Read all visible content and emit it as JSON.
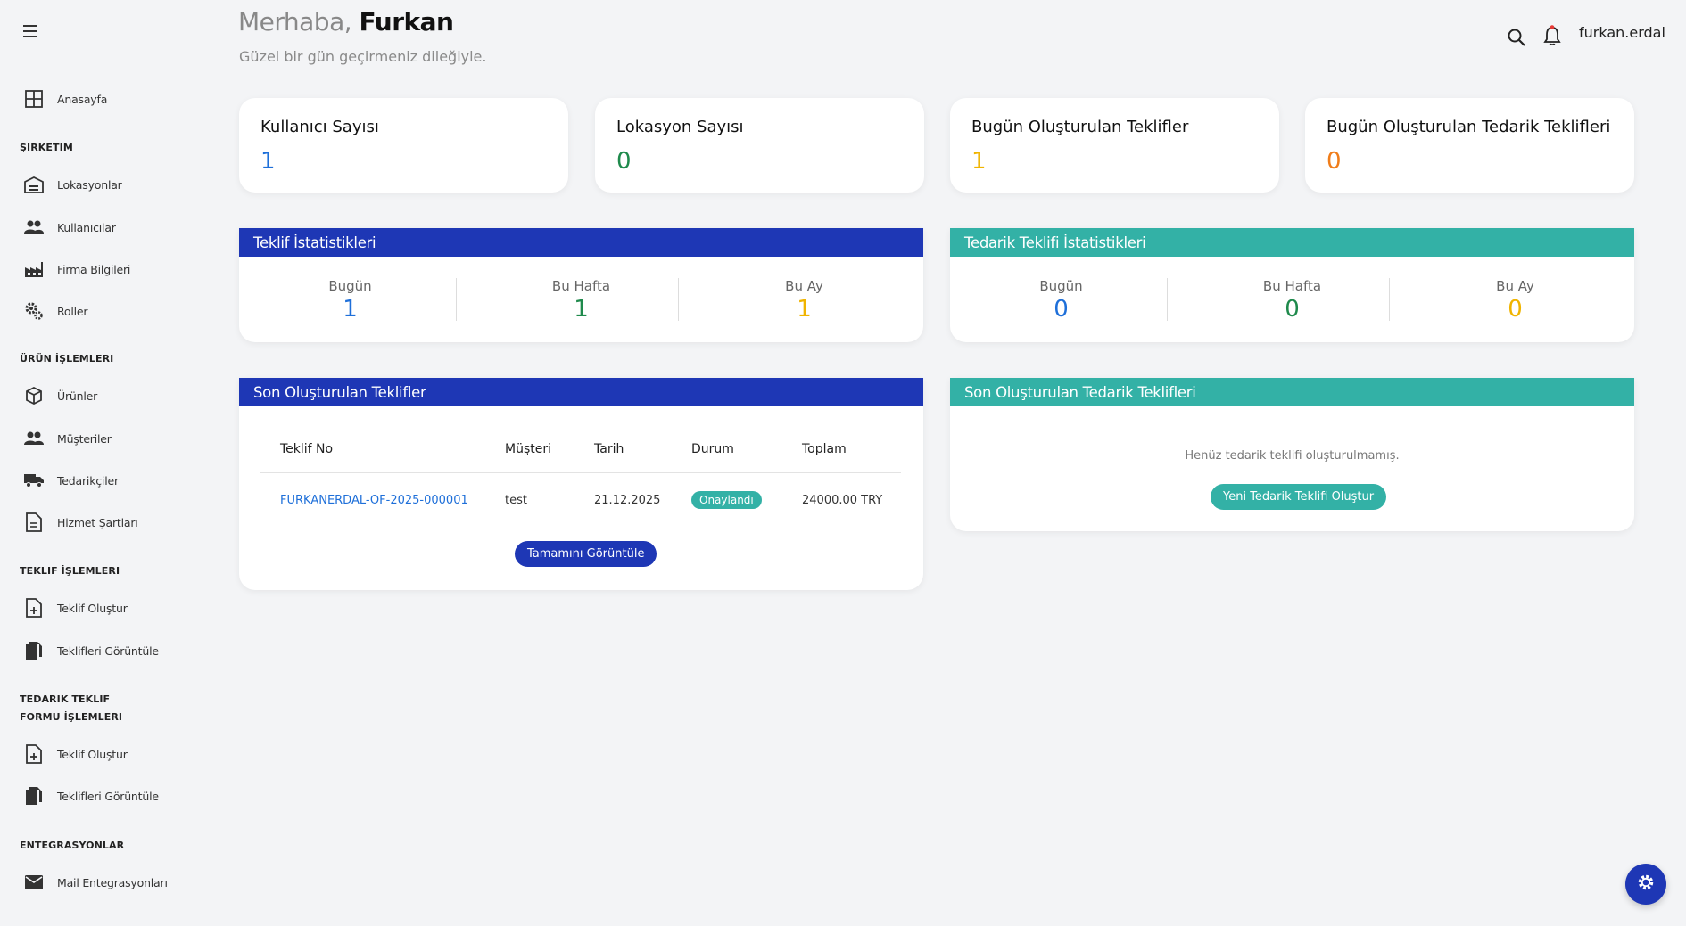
{
  "header": {
    "greeting_prefix": "Merhaba,",
    "user_name": "Furkan",
    "subtitle": "Güzel bir gün geçirmeniz dileğiyle.",
    "username": "furkan.erdal"
  },
  "sidebar": {
    "home": "Anasayfa",
    "sections": [
      {
        "title": "ŞIRKETIM",
        "items": [
          "Lokasyonlar",
          "Kullanıcılar",
          "Firma Bilgileri",
          "Roller"
        ]
      },
      {
        "title": "ÜRÜN İŞLEMLERI",
        "items": [
          "Ürünler",
          "Müşteriler",
          "Tedarikçiler",
          "Hizmet Şartları"
        ]
      },
      {
        "title": "TEKLIF İŞLEMLERI",
        "items": [
          "Teklif Oluştur",
          "Teklifleri Görüntüle"
        ]
      },
      {
        "title": "TEDARIK TEKLIF FORMU İŞLEMLERI",
        "items": [
          "Teklif Oluştur",
          "Teklifleri Görüntüle"
        ]
      },
      {
        "title": "ENTEGRASYONLAR",
        "items": [
          "Mail Entegrasyonları"
        ]
      }
    ]
  },
  "cards": [
    {
      "title": "Kullanıcı Sayısı",
      "value": "1",
      "color": "#1e6fd9"
    },
    {
      "title": "Lokasyon Sayısı",
      "value": "0",
      "color": "#1f8a4c"
    },
    {
      "title": "Bugün Oluşturulan Teklifler",
      "value": "1",
      "color": "#f0b400"
    },
    {
      "title": "Bugün Oluşturulan Tedarik Teklifleri",
      "value": "0",
      "color": "#f07d1a"
    }
  ],
  "offer_stats": {
    "title": "Teklif İstatistikleri",
    "cols": [
      {
        "label": "Bugün",
        "value": "1"
      },
      {
        "label": "Bu Hafta",
        "value": "1"
      },
      {
        "label": "Bu Ay",
        "value": "1"
      }
    ]
  },
  "supply_stats": {
    "title": "Tedarik Teklifi İstatistikleri",
    "cols": [
      {
        "label": "Bugün",
        "value": "0"
      },
      {
        "label": "Bu Hafta",
        "value": "0"
      },
      {
        "label": "Bu Ay",
        "value": "0"
      }
    ]
  },
  "recent_offers": {
    "title": "Son Oluşturulan Teklifler",
    "columns": [
      "Teklif No",
      "Müşteri",
      "Tarih",
      "Durum",
      "Toplam"
    ],
    "rows": [
      {
        "no": "FURKANERDAL-OF-2025-000001",
        "customer": "test",
        "date": "21.12.2025",
        "status": "Onaylandı",
        "total": "24000.00 TRY"
      }
    ],
    "button": "Tamamını Görüntüle"
  },
  "recent_supply": {
    "title": "Son Oluşturulan Tedarik Teklifleri",
    "empty_text": "Henüz tedarik teklifi oluşturulmamış.",
    "button": "Yeni Tedarik Teklifi Oluştur"
  },
  "colors": {
    "primary": "#1e37b5",
    "teal": "#33b1a6",
    "blue_value": "#1e6fd9",
    "green_value": "#1f8a4c",
    "yellow_value": "#f0b400",
    "orange_value": "#f07d1a"
  }
}
